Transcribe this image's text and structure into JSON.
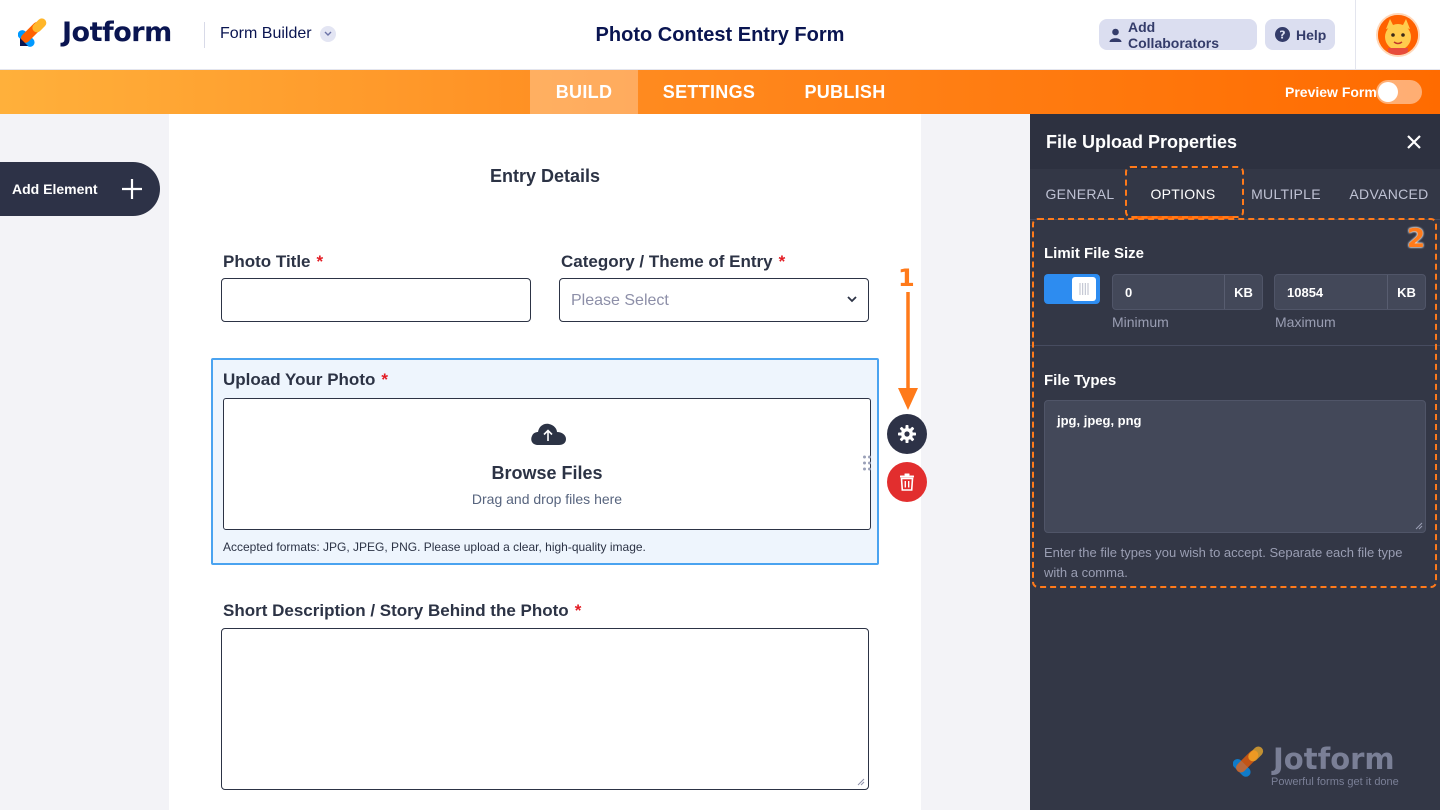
{
  "header": {
    "brand": "Jotform",
    "builder_label": "Form Builder",
    "form_title": "Photo Contest Entry Form",
    "collaborators_label": "Add Collaborators",
    "help_label": "Help"
  },
  "nav": {
    "tabs": [
      {
        "label": "BUILD",
        "active": true
      },
      {
        "label": "SETTINGS",
        "active": false
      },
      {
        "label": "PUBLISH",
        "active": false
      }
    ],
    "preview_label": "Preview Form",
    "preview_on": false
  },
  "sidebar": {
    "add_element_label": "Add Element"
  },
  "form": {
    "section_title": "Entry Details",
    "photo_title": {
      "label": "Photo Title",
      "required_mark": "*",
      "value": ""
    },
    "category": {
      "label": "Category / Theme of Entry",
      "required_mark": "*",
      "placeholder": "Please Select"
    },
    "upload": {
      "label": "Upload Your Photo",
      "required_mark": "*",
      "browse_label": "Browse Files",
      "drag_text": "Drag and drop files here",
      "sublabel": "Accepted formats: JPG, JPEG, PNG. Please upload a clear, high-quality image."
    },
    "description": {
      "label": "Short Description / Story Behind the Photo",
      "required_mark": "*",
      "value": ""
    }
  },
  "annotations": {
    "step1": "1",
    "step2": "2"
  },
  "panel": {
    "title": "File Upload Properties",
    "tabs": [
      {
        "label": "GENERAL",
        "active": false
      },
      {
        "label": "OPTIONS",
        "active": true
      },
      {
        "label": "MULTIPLE",
        "active": false
      },
      {
        "label": "ADVANCED",
        "active": false
      }
    ],
    "limit_file_size": {
      "title": "Limit File Size",
      "enabled": true,
      "min_value": "0",
      "min_unit": "KB",
      "min_caption": "Minimum",
      "max_value": "10854",
      "max_unit": "KB",
      "max_caption": "Maximum"
    },
    "file_types": {
      "title": "File Types",
      "value": "jpg, jpeg, png",
      "help": "Enter the file types you wish to accept. Separate each file type with a comma."
    }
  },
  "watermark": {
    "brand": "Jotform",
    "tagline": "Powerful forms get it done"
  },
  "colors": {
    "accent_orange": "#ff6100",
    "primary_blue": "#2d8cf0",
    "danger_red": "#e22e2e",
    "navy": "#0a1551"
  }
}
